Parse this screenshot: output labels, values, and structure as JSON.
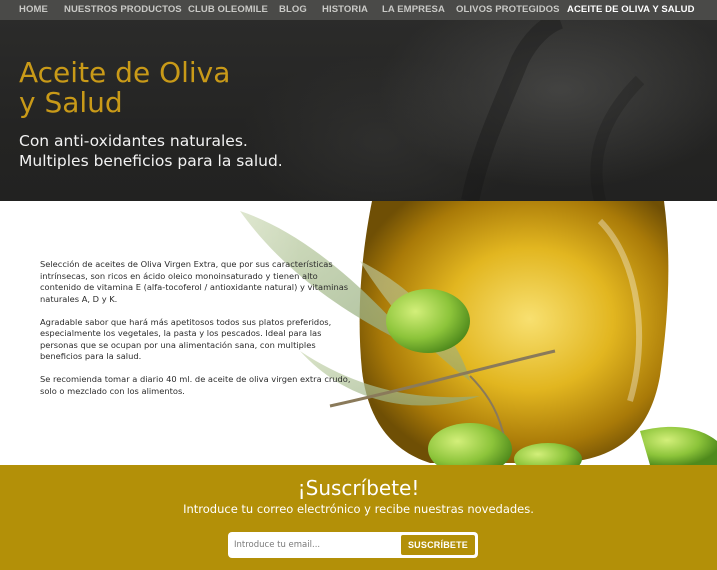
{
  "nav": {
    "items": [
      {
        "label": "HOME"
      },
      {
        "label": "NUESTROS PRODUCTOS"
      },
      {
        "label": "CLUB OLEOMILE"
      },
      {
        "label": "BLOG"
      },
      {
        "label": "HISTORIA"
      },
      {
        "label": "LA EMPRESA"
      },
      {
        "label": "OLIVOS PROTEGIDOS"
      },
      {
        "label": "ACEITE DE OLIVA Y SALUD"
      }
    ],
    "active_index": 7
  },
  "hero": {
    "title_line1": "Aceite de Oliva",
    "title_line2": "y Salud",
    "subtitle_line1": "Con anti-oxidantes naturales.",
    "subtitle_line2": "Multiples beneficios para la salud."
  },
  "content": {
    "paragraph1": "Selección de aceites de Oliva Virgen Extra, que por sus características intrínsecas, son ricos en ácido oleico monoinsaturado y tienen alto contenido de vitamina E (alfa-tocoferol / antioxidante natural) y vitaminas naturales A, D y K.",
    "paragraph2": "Agradable sabor que hará más apetitosos todos sus platos preferidos, especialmente los vegetales, la pasta y los pescados. Ideal para las personas que se ocupan por una alimentación sana, con multiples beneficios para la salud.",
    "paragraph3": "Se recomienda tomar a diario 40 ml. de aceite de oliva virgen extra crudo, solo o mezclado con los alimentos."
  },
  "subscribe": {
    "title": "¡Suscríbete!",
    "text": "Introduce tu correo electrónico y recibe nuestras novedades.",
    "input_placeholder": "Introduce tu email...",
    "input_value": "",
    "button_label": "SUSCRÍBETE"
  },
  "colors": {
    "accent_gold": "#b39008",
    "title_gold": "#c99a18",
    "nav_bg": "#4a4a48",
    "hero_bg": "#242423"
  }
}
